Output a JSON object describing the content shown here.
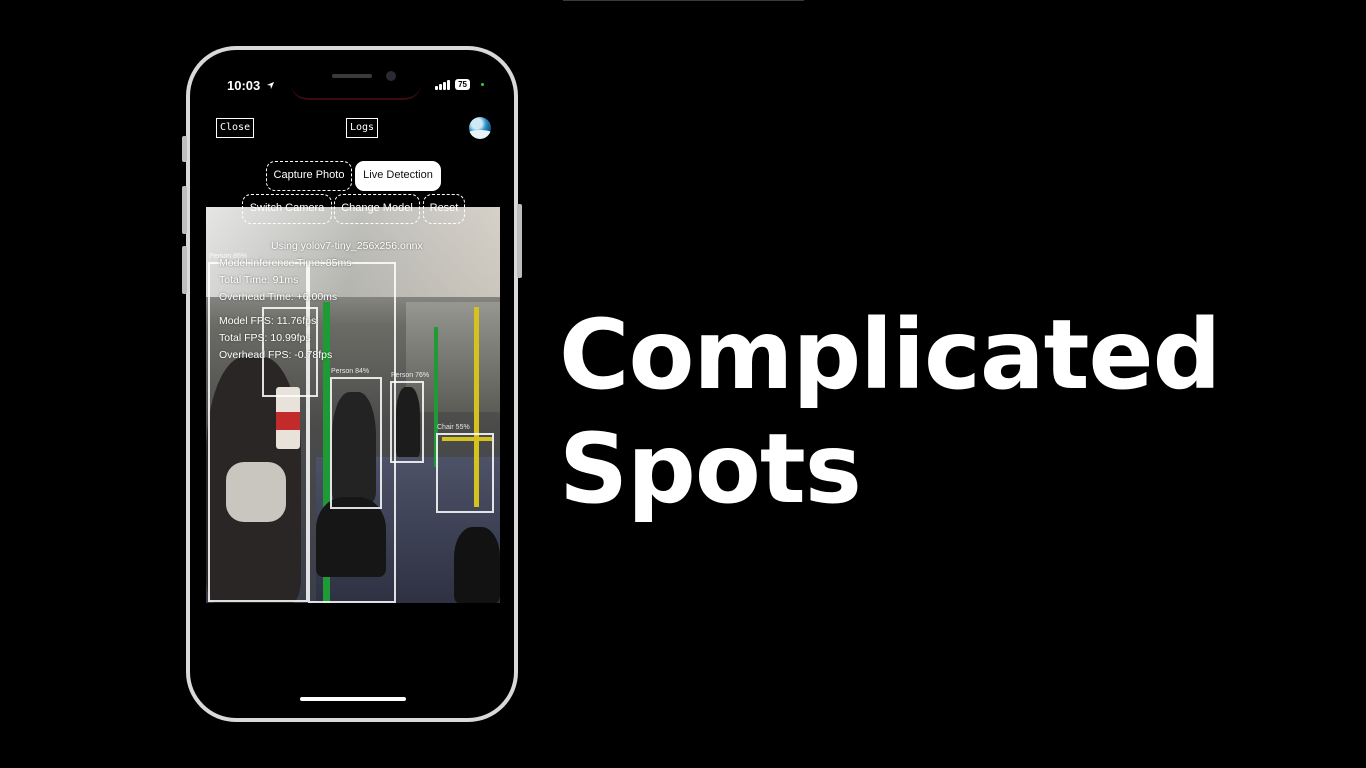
{
  "status_bar": {
    "time": "10:03",
    "battery": "75"
  },
  "toolbar": {
    "close_label": "Close",
    "logs_label": "Logs"
  },
  "mode_buttons": {
    "capture_photo": "Capture Photo",
    "live_detection": "Live Detection"
  },
  "action_buttons": {
    "switch_camera": "Switch Camera",
    "change_model": "Change Model",
    "reset": "Reset"
  },
  "stats": {
    "model_name": "Using yolov7-tiny_256x256.onnx",
    "model_inference_time": "Model Inference Time: 85ms",
    "total_time": "Total Time: 91ms",
    "overhead_time": "Overhead Time: +6.00ms",
    "model_fps": "Model FPS: 11.76fps",
    "total_fps": "Total FPS: 10.99fps",
    "overhead_fps": "Overhead FPS: -0.78fps"
  },
  "detections": [
    {
      "label": "Person 86%"
    },
    {
      "label": "Person 84%"
    },
    {
      "label": "Person 76%"
    },
    {
      "label": "Chair 55%"
    }
  ],
  "headline": {
    "line1": "Complicated",
    "line2": "Spots"
  },
  "colors": {
    "background": "#000000",
    "phone_frame": "#d9d9d9",
    "accent_text": "#ffffff"
  },
  "icons": [
    "location-arrow-icon",
    "signal-icon",
    "battery-icon",
    "globe-icon"
  ]
}
